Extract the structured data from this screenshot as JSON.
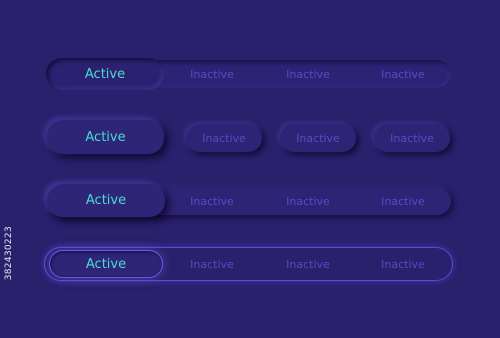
{
  "rows": [
    {
      "style": "pressed-active",
      "tabs": [
        {
          "label": "Active",
          "state": "active"
        },
        {
          "label": "Inactive",
          "state": "inactive"
        },
        {
          "label": "Inactive",
          "state": "inactive"
        },
        {
          "label": "Inactive",
          "state": "inactive"
        }
      ]
    },
    {
      "style": "separate-raised",
      "tabs": [
        {
          "label": "Active",
          "state": "active"
        },
        {
          "label": "Inactive",
          "state": "inactive"
        },
        {
          "label": "Inactive",
          "state": "inactive"
        },
        {
          "label": "Inactive",
          "state": "inactive"
        }
      ]
    },
    {
      "style": "raised-active",
      "tabs": [
        {
          "label": "Active",
          "state": "active"
        },
        {
          "label": "Inactive",
          "state": "inactive"
        },
        {
          "label": "Inactive",
          "state": "inactive"
        },
        {
          "label": "Inactive",
          "state": "inactive"
        }
      ]
    },
    {
      "style": "outlined-glow",
      "tabs": [
        {
          "label": "Active",
          "state": "active"
        },
        {
          "label": "Inactive",
          "state": "inactive"
        },
        {
          "label": "Inactive",
          "state": "inactive"
        },
        {
          "label": "Inactive",
          "state": "inactive"
        }
      ]
    }
  ],
  "stock_id": "382430223",
  "colors": {
    "background": "#2a206c",
    "active_text": "#46dbd4",
    "inactive_text": "#5a48c6",
    "outline": "#6b56e6"
  }
}
